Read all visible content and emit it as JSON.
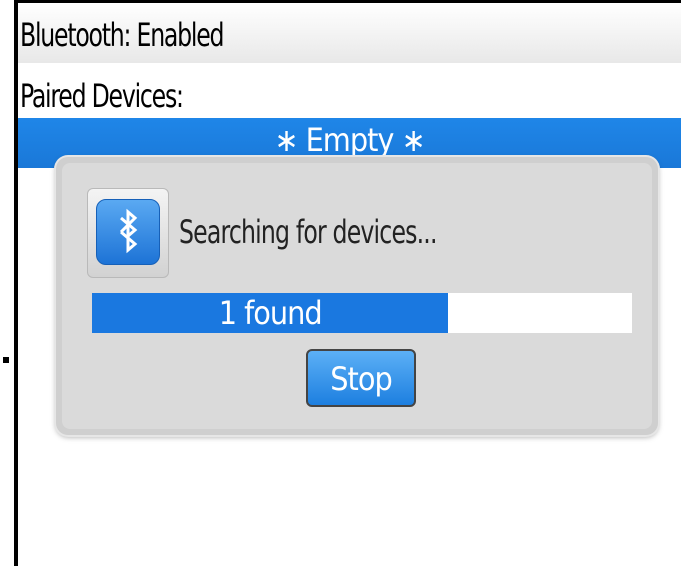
{
  "screen": {
    "bluetooth_status": "Bluetooth: Enabled",
    "paired_devices_label": "Paired Devices:",
    "paired_devices_empty": "∗ Empty ∗"
  },
  "dialog": {
    "icon": "bluetooth-icon",
    "message": "Searching for devices...",
    "progress": {
      "label": "1 found",
      "fraction": 0.66
    },
    "stop_label": "Stop"
  },
  "colors": {
    "highlight": "#1a78d8",
    "progress_fill": "#1a78e0",
    "button": "#1d7fe0",
    "dialog_bg": "#dadada"
  }
}
